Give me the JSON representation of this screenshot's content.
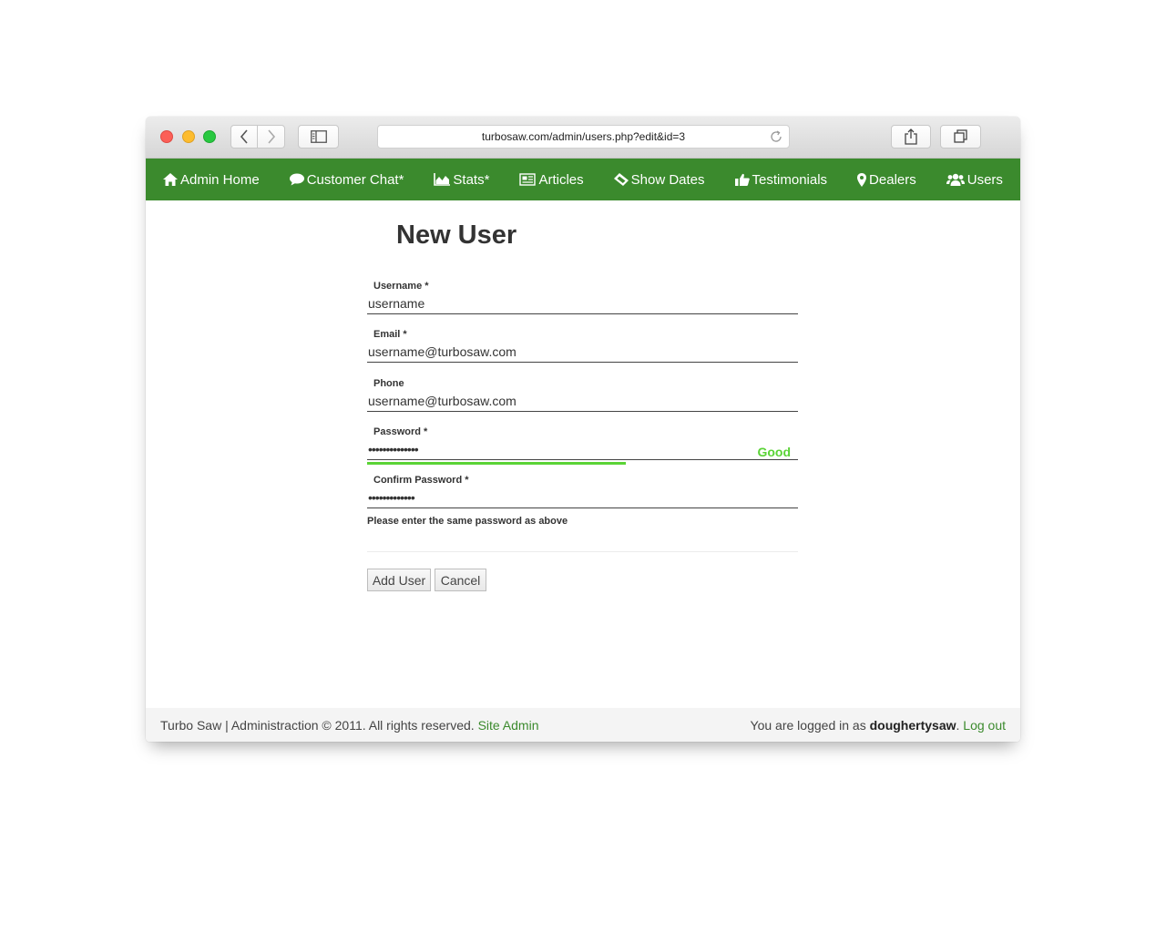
{
  "browser": {
    "url": "turbosaw.com/admin/users.php?edit&id=3"
  },
  "nav": {
    "items": [
      {
        "label": "Admin Home",
        "icon": "home-icon"
      },
      {
        "label": "Customer Chat*",
        "icon": "comment-icon"
      },
      {
        "label": "Stats*",
        "icon": "area-chart-icon"
      },
      {
        "label": "Articles",
        "icon": "newspaper-icon"
      },
      {
        "label": "Show Dates",
        "icon": "ticket-icon"
      },
      {
        "label": "Testimonials",
        "icon": "thumbs-up-icon"
      },
      {
        "label": "Dealers",
        "icon": "map-marker-icon"
      },
      {
        "label": "Users",
        "icon": "users-icon"
      }
    ],
    "color": "#3b8a2d"
  },
  "form": {
    "title": "New User",
    "username": {
      "label": "Username *",
      "value": "username"
    },
    "email": {
      "label": "Email *",
      "value": "username@turbosaw.com"
    },
    "phone": {
      "label": "Phone",
      "value": "username@turbosaw.com"
    },
    "password": {
      "label": "Password *",
      "value": "••••••••••••••",
      "strength_label": "Good",
      "strength_fraction": 0.6,
      "strength_color": "#5ad336"
    },
    "confirm_password": {
      "label": "Confirm Password *",
      "value": "•••••••••••••"
    },
    "hint": "Please enter the same password as above",
    "add_button": "Add User",
    "cancel_button": "Cancel"
  },
  "footer": {
    "left_text": "Turbo Saw | Administraction © 2011. All rights reserved.",
    "site_admin_link": "Site Admin",
    "logged_in_prefix": "You are logged in as",
    "username": "doughertysaw",
    "separator": ".",
    "logout_link": "Log out"
  }
}
